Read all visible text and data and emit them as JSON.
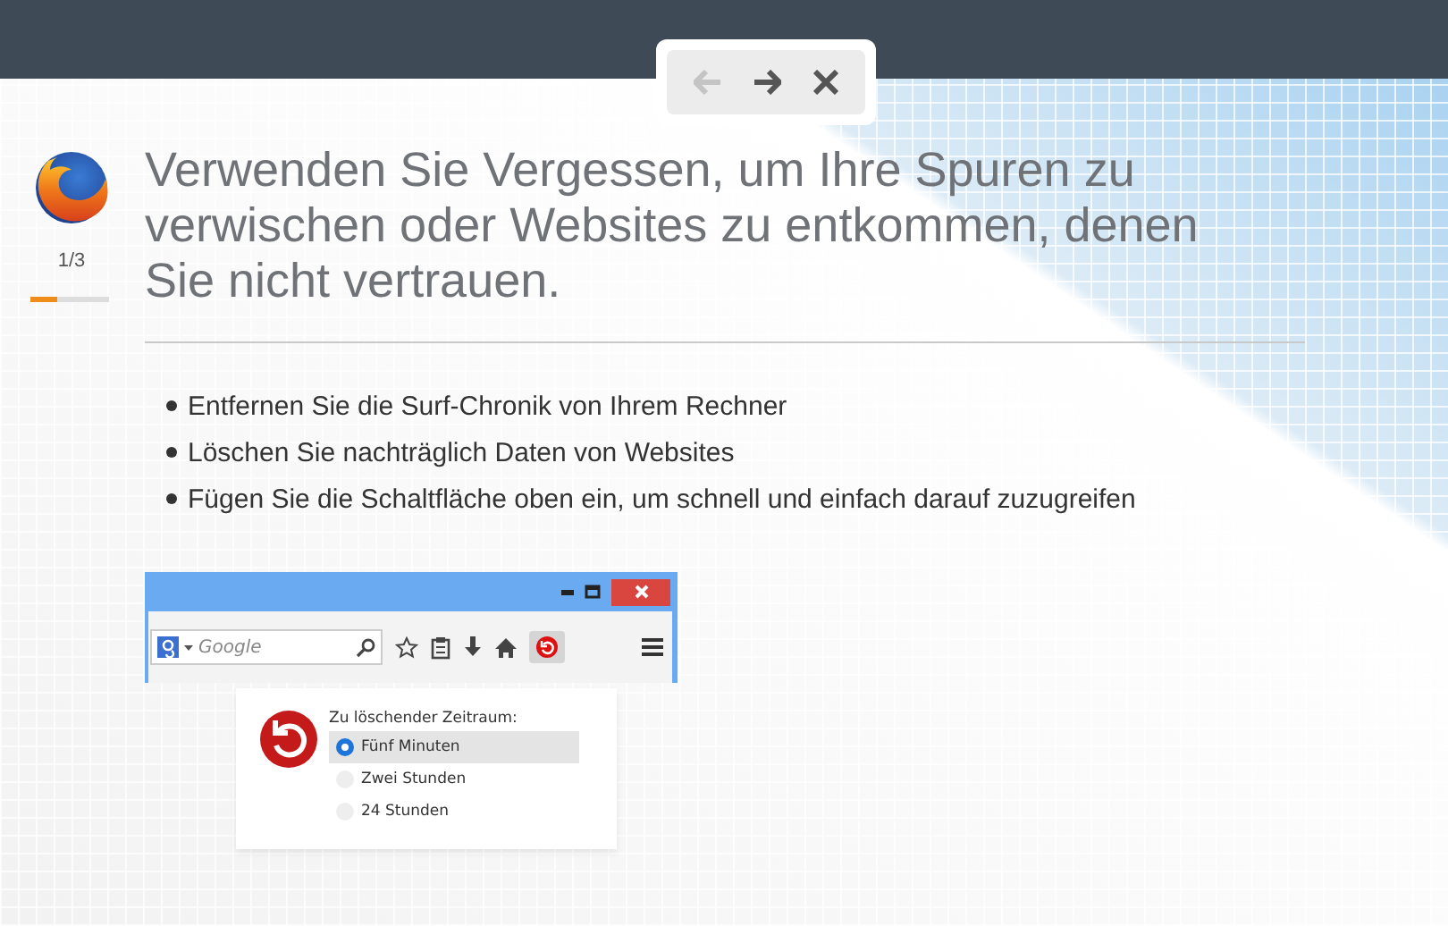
{
  "nav": {
    "buttons": [
      {
        "kind": "back",
        "disabled": true
      },
      {
        "kind": "forward",
        "disabled": false
      },
      {
        "kind": "close",
        "disabled": false
      }
    ]
  },
  "progress": {
    "counter": "1/3",
    "level": 0.33
  },
  "headline": "Verwenden Sie Vergessen, um Ihre Spuren zu verwischen oder Websites zu entkommen, denen Sie nicht vertrauen.",
  "bullets": [
    "Entfernen Sie die Surf-Chronik von Ihrem Rechner",
    "Löschen Sie nachträglich Daten von Websites",
    "Fügen Sie die Schaltfläche oben ein, um schnell und einfach darauf zuzugreifen"
  ],
  "illustration": {
    "search": {
      "placeholder": "Google"
    },
    "popup": {
      "title": "Zu löschender Zeitraum:",
      "options": [
        {
          "label": "Fünf Minuten",
          "selected": true
        },
        {
          "label": "Zwei Stunden",
          "selected": false
        },
        {
          "label": "24 Stunden",
          "selected": false
        }
      ]
    }
  }
}
